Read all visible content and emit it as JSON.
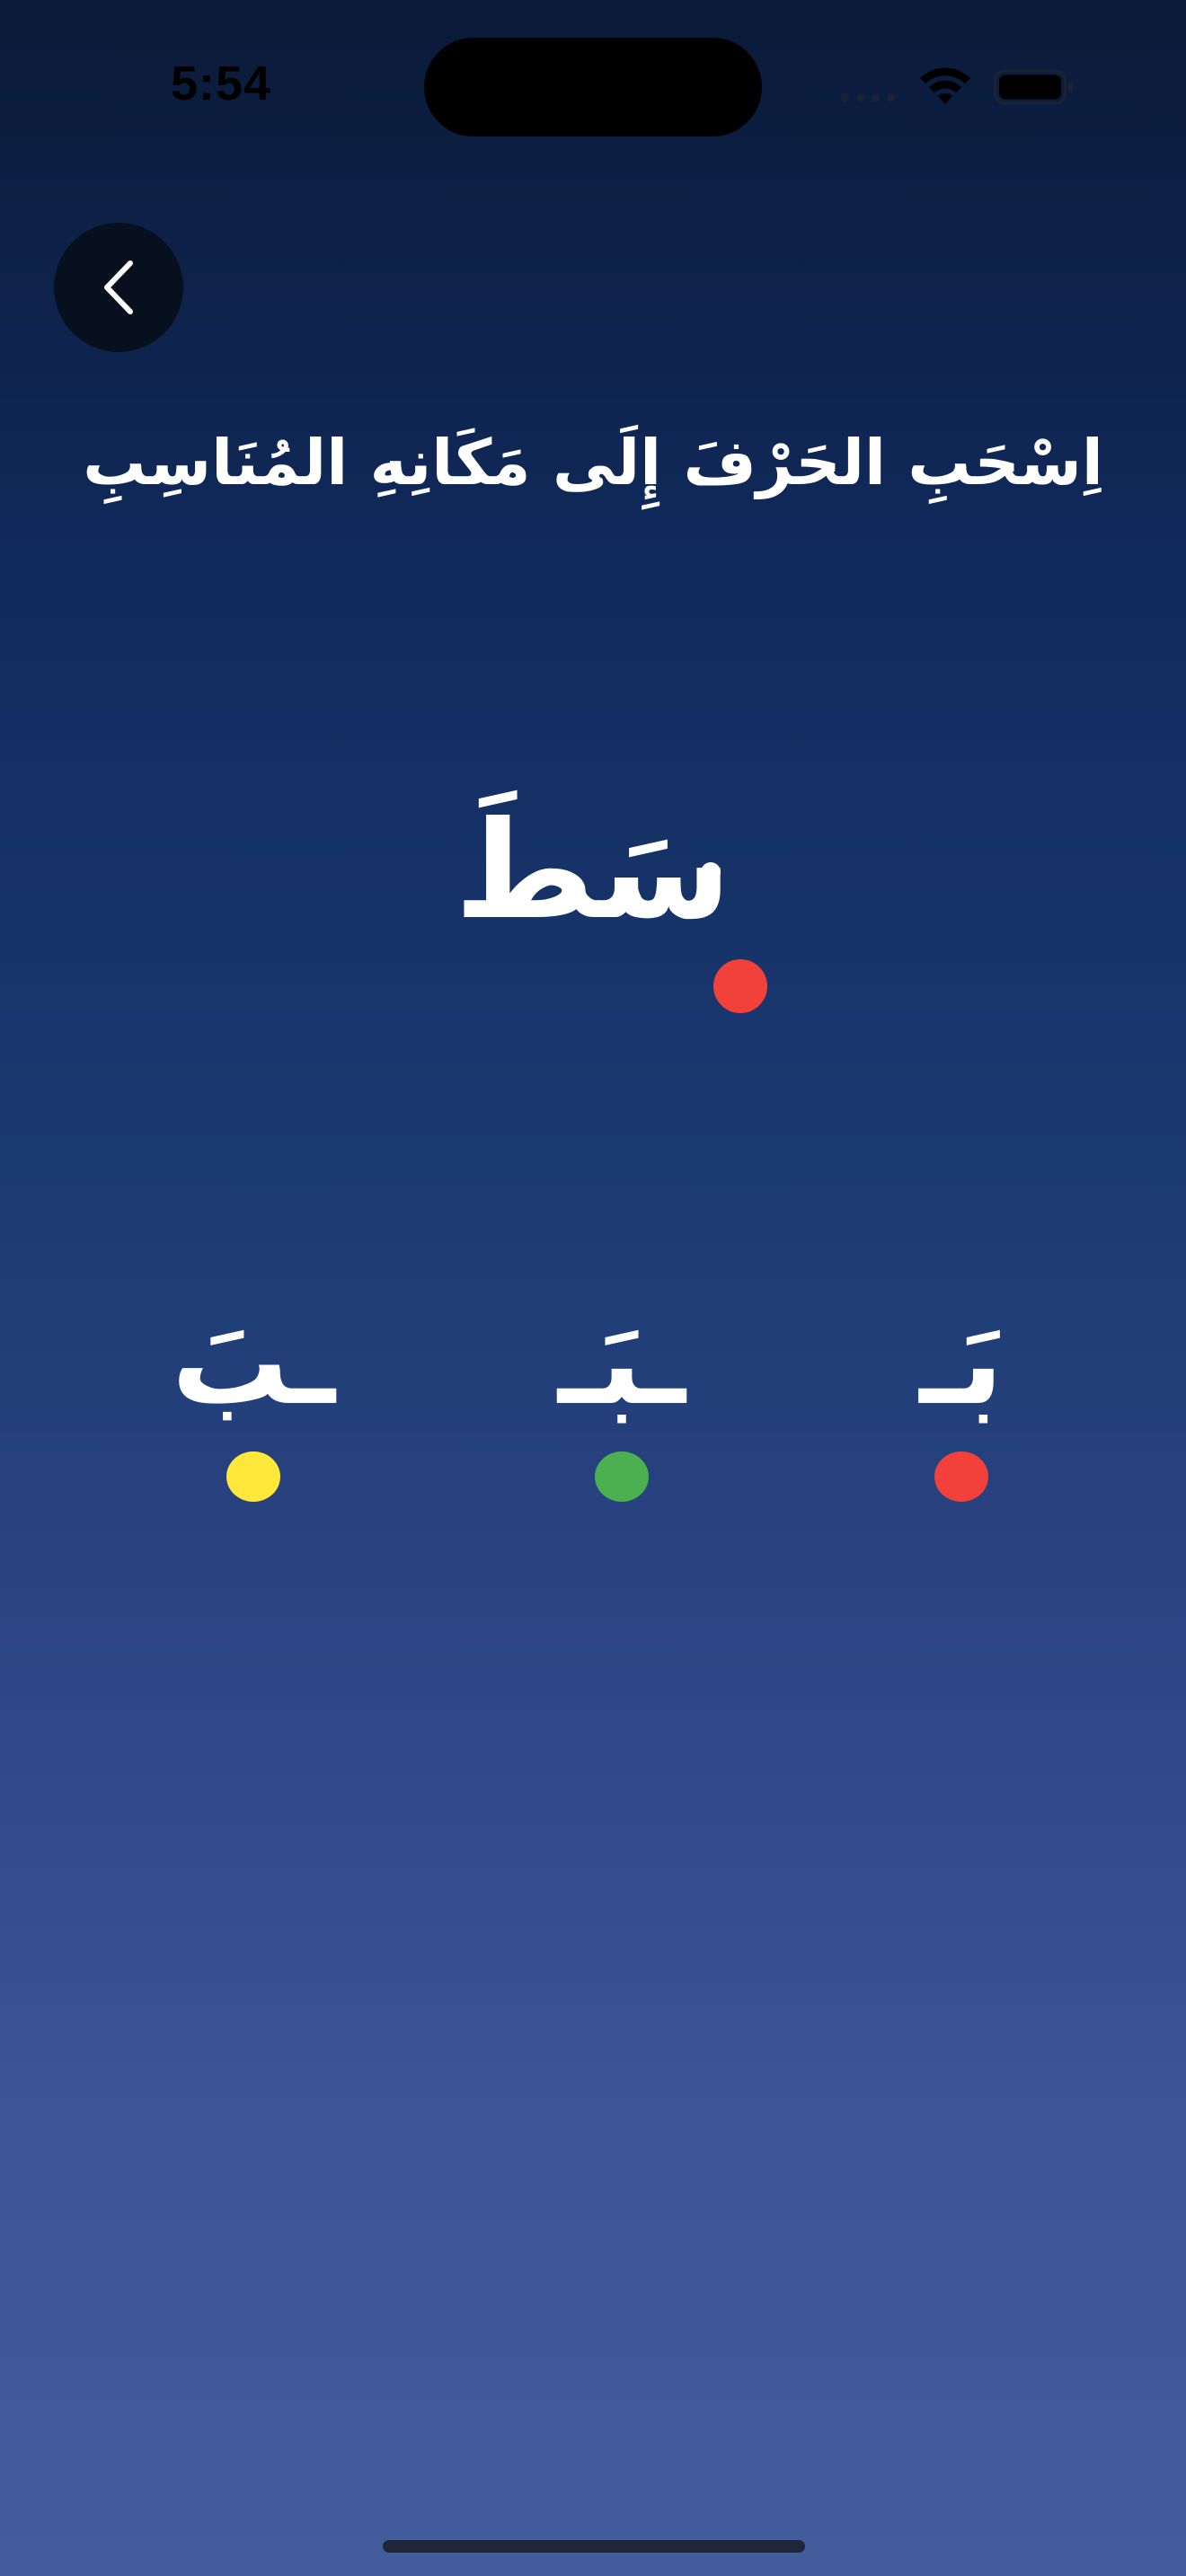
{
  "status_bar": {
    "time": "5:54",
    "icons": [
      "cellular-dots-icon",
      "wifi-icon",
      "battery-icon"
    ]
  },
  "header": {
    "back_icon": "chevron-left-icon"
  },
  "instruction": "اِسْحَبِ الحَرْفَ إِلَى مَكَانِهِ المُنَاسِبِ",
  "target_word": "سَطَ",
  "drop_target_color": "#f2403a",
  "options": [
    {
      "letter": "ـبَ",
      "dot_color": "#ffe83a"
    },
    {
      "letter": "ـبَـ",
      "dot_color": "#4caf50"
    },
    {
      "letter": "بَـ",
      "dot_color": "#f2403a"
    }
  ],
  "colors": {
    "background_top": "#0a1a38",
    "background_bottom": "#425c9c",
    "text": "#ffffff",
    "back_button_bg": "#06101f"
  }
}
